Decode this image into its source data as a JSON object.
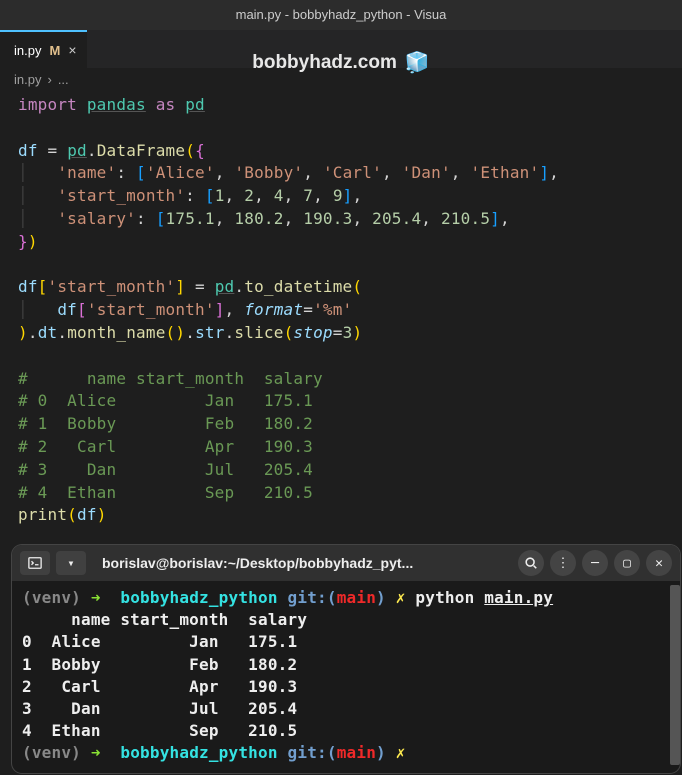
{
  "window": {
    "title": "main.py - bobbyhadz_python - Visua"
  },
  "tab": {
    "filename": "in.py",
    "status_letter": "M",
    "close_glyph": "×"
  },
  "watermark": {
    "text": "bobbyhadz.com",
    "emoji": "🧊"
  },
  "breadcrumb": {
    "file": "in.py",
    "sep": "›",
    "more": "..."
  },
  "code": {
    "import_kw": "import",
    "pandas": "pandas",
    "as_kw": "as",
    "pd": "pd",
    "df": "df",
    "eq": "=",
    "DataFrame": "DataFrame",
    "keys": {
      "name": "'name'",
      "start_month": "'start_month'",
      "salary": "'salary'"
    },
    "names": [
      "'Alice'",
      "'Bobby'",
      "'Carl'",
      "'Dan'",
      "'Ethan'"
    ],
    "months": [
      "1",
      "2",
      "4",
      "7",
      "9"
    ],
    "salaries": [
      "175.1",
      "180.2",
      "190.3",
      "205.4",
      "210.5"
    ],
    "to_datetime": "to_datetime",
    "format_kw": "format",
    "format_val": "'%m'",
    "dt": "dt",
    "month_name": "month_name",
    "str_attr": "str",
    "slice": "slice",
    "stop_kw": "stop",
    "stop_val": "3",
    "print": "print",
    "comment_header": "#      name start_month  salary",
    "comment_rows": [
      "# 0  Alice         Jan   175.1",
      "# 1  Bobby         Feb   180.2",
      "# 2   Carl         Apr   190.3",
      "# 3    Dan         Jul   205.4",
      "# 4  Ethan         Sep   210.5"
    ]
  },
  "terminal": {
    "tab_title": "borislav@borislav:~/Desktop/bobbyhadz_pyt...",
    "venv": "(venv)",
    "arrow": "➜",
    "folder": "bobbyhadz_python",
    "git_label": "git:(",
    "branch": "main",
    "git_close": ")",
    "dirty": "✗",
    "cmd": "python",
    "arg": "main.py",
    "output_header": "     name start_month  salary",
    "output_rows": [
      "0  Alice         Jan   175.1",
      "1  Bobby         Feb   180.2",
      "2   Carl         Apr   190.3",
      "3    Dan         Jul   205.4",
      "4  Ethan         Sep   210.5"
    ]
  }
}
